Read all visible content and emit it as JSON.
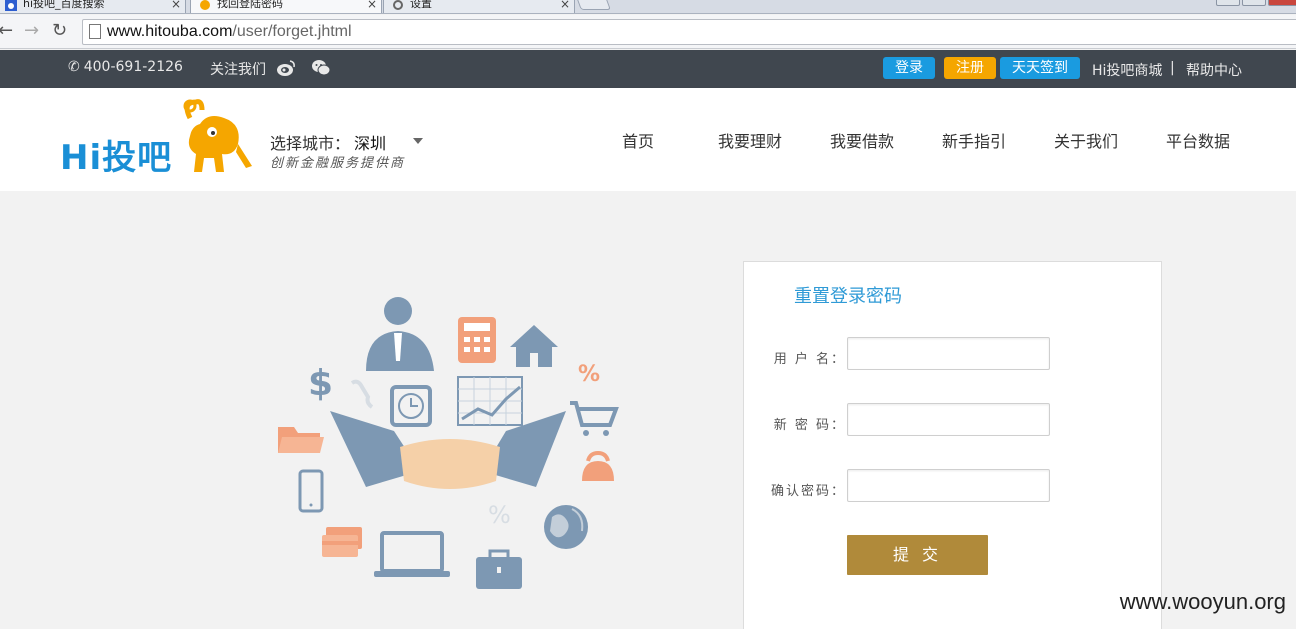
{
  "browser": {
    "tabs": [
      {
        "title": "hi投吧_百度搜索",
        "active": false
      },
      {
        "title": "找回登陆密码",
        "active": true
      },
      {
        "title": "设置",
        "active": false
      }
    ],
    "url_host": "www.hitouba.com",
    "url_path": "/user/forget.jhtml"
  },
  "topbar": {
    "phone": "400-691-2126",
    "follow": "关注我们",
    "login": "登录",
    "register": "注册",
    "signin": "天天签到",
    "mall": "Hi投吧商城",
    "separator": "|",
    "help": "帮助中心",
    "colors": {
      "login": "#1a9be0",
      "register": "#f5a600",
      "signin": "#1a9be0"
    }
  },
  "header": {
    "logo_text": "Hi投吧",
    "city_label": "选择城市：",
    "city_value": "深圳",
    "slogan": "创新金融服务提供商",
    "nav": [
      "首页",
      "我要理财",
      "我要借款",
      "新手指引",
      "关于我们",
      "平台数据"
    ]
  },
  "form": {
    "title": "重置登录密码",
    "username_label": "用 户 名：",
    "username_value": "",
    "new_password_label": "新 密 码：",
    "new_password_value": "",
    "confirm_label": "确认密码：",
    "confirm_value": "",
    "submit": "提 交"
  },
  "watermark": "www.wooyun.org"
}
